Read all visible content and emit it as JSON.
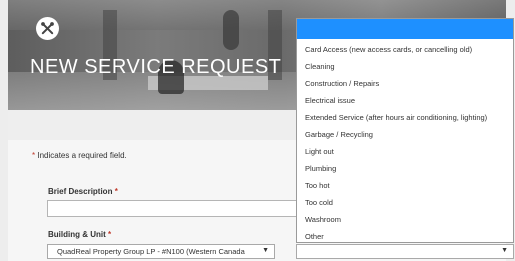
{
  "header": {
    "title": "NEW SERVICE REQUEST",
    "icon": "tools-icon"
  },
  "form": {
    "required_note": "Indicates a required field.",
    "required_mark": "*",
    "brief_description": {
      "label": "Brief Description",
      "value": ""
    },
    "building_unit": {
      "label": "Building & Unit",
      "selected": "QuadReal Property Group LP - #N100 (Western Canada"
    }
  },
  "issue_type": {
    "selected": "",
    "options": [
      "Card Access (new access cards, or cancelling old)",
      "Cleaning",
      "Construction / Repairs",
      "Electrical issue",
      "Extended Service (after hours air conditioning, lighting)",
      "Garbage / Recycling",
      "Light out",
      "Plumbing",
      "Too hot",
      "Too cold",
      "Washroom",
      "Other"
    ]
  },
  "colors": {
    "highlight": "#1e90ff",
    "required": "#c0392b"
  }
}
